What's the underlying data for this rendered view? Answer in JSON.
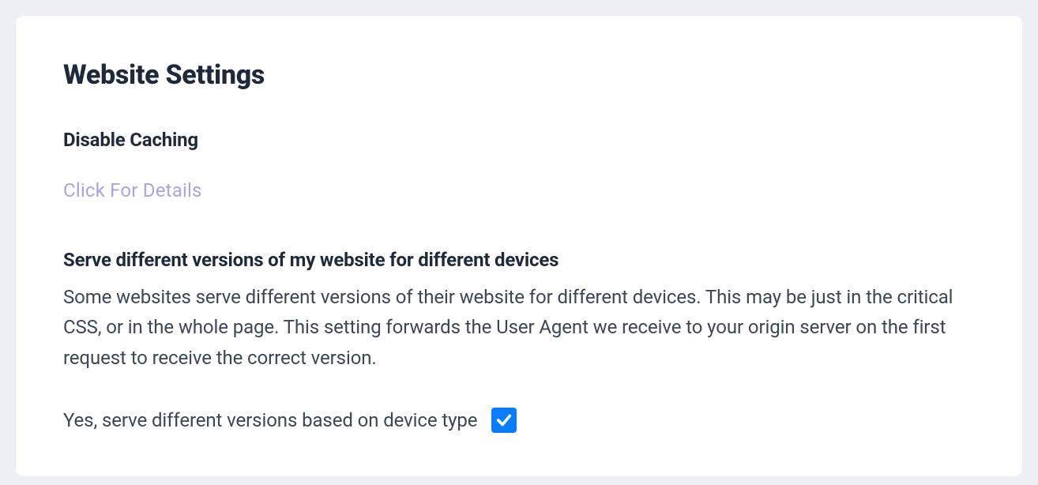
{
  "title": "Website Settings",
  "disable_caching": {
    "heading": "Disable Caching",
    "details_link": "Click For Details"
  },
  "device_versions": {
    "heading": "Serve different versions of my website for different devices",
    "description": "Some websites serve different versions of their website for different devices. This may be just in the critical CSS, or in the whole page. This setting forwards the User Agent we receive to your origin server on the first request to receive the correct version.",
    "checkbox_label": "Yes, serve different versions based on device type",
    "checked": true
  },
  "colors": {
    "accent": "#0a7cff",
    "link": "#aea1e6",
    "heading": "#1e2a3b",
    "body": "#3b4657"
  }
}
